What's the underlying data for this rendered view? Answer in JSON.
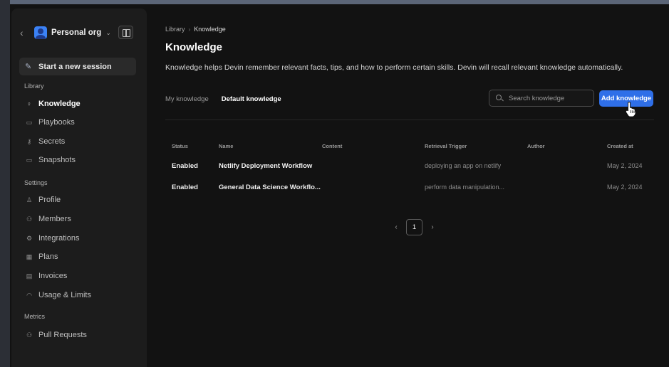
{
  "sidebar": {
    "org_name": "Personal org",
    "new_session_label": "Start a new session",
    "sections": {
      "library": "Library",
      "settings": "Settings",
      "metrics": "Metrics"
    },
    "library_items": [
      "Knowledge",
      "Playbooks",
      "Secrets",
      "Snapshots"
    ],
    "settings_items": [
      "Profile",
      "Members",
      "Integrations",
      "Plans",
      "Invoices",
      "Usage & Limits"
    ],
    "metrics_items": [
      "Pull Requests"
    ]
  },
  "main": {
    "breadcrumb": [
      "Library",
      "Knowledge"
    ],
    "title": "Knowledge",
    "description": "Knowledge helps Devin remember relevant facts, tips, and how to perform certain skills. Devin will recall relevant knowledge automatically.",
    "tabs": [
      "My knowledge",
      "Default knowledge"
    ],
    "active_tab": "Default knowledge",
    "search_placeholder": "Search knowledge",
    "add_button_label": "Add knowledge",
    "table": {
      "headers": [
        "Status",
        "Name",
        "Content",
        "Retrieval Trigger",
        "Author",
        "Created at"
      ],
      "rows": [
        {
          "status": "Enabled",
          "name": "Netlify Deployment Workflow",
          "content": "",
          "trigger": "deploying an app on netlify",
          "author": "",
          "created": "May 2, 2024"
        },
        {
          "status": "Enabled",
          "name": "General Data Science Workflo...",
          "content": "",
          "trigger": "perform data manipulation...",
          "author": "",
          "created": "May 2, 2024"
        }
      ]
    },
    "pagination": {
      "current_page": "1"
    }
  },
  "colors": {
    "accent": "#2f6fe8",
    "background": "#121212",
    "sidebar": "#1c1c1c"
  }
}
